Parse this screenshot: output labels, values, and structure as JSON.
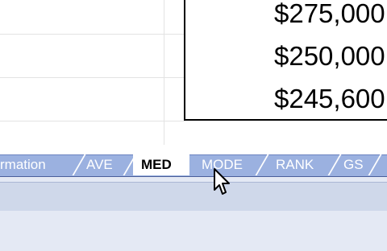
{
  "cells": [
    {
      "value": "$275,000"
    },
    {
      "value": "$250,000"
    },
    {
      "value": "$245,600"
    }
  ],
  "sheet_tabs": {
    "items": [
      {
        "label": "rmation"
      },
      {
        "label": "AVE"
      },
      {
        "label": "MED"
      },
      {
        "label": "MODE"
      },
      {
        "label": "RANK"
      },
      {
        "label": "GS"
      }
    ],
    "active": "MED"
  },
  "colors": {
    "tab_strip": "#9bb1e0",
    "active_tab": "#ffffff",
    "chrome": "#cfd8ea"
  },
  "cursor": {
    "icon": "mouse-pointer-icon"
  }
}
